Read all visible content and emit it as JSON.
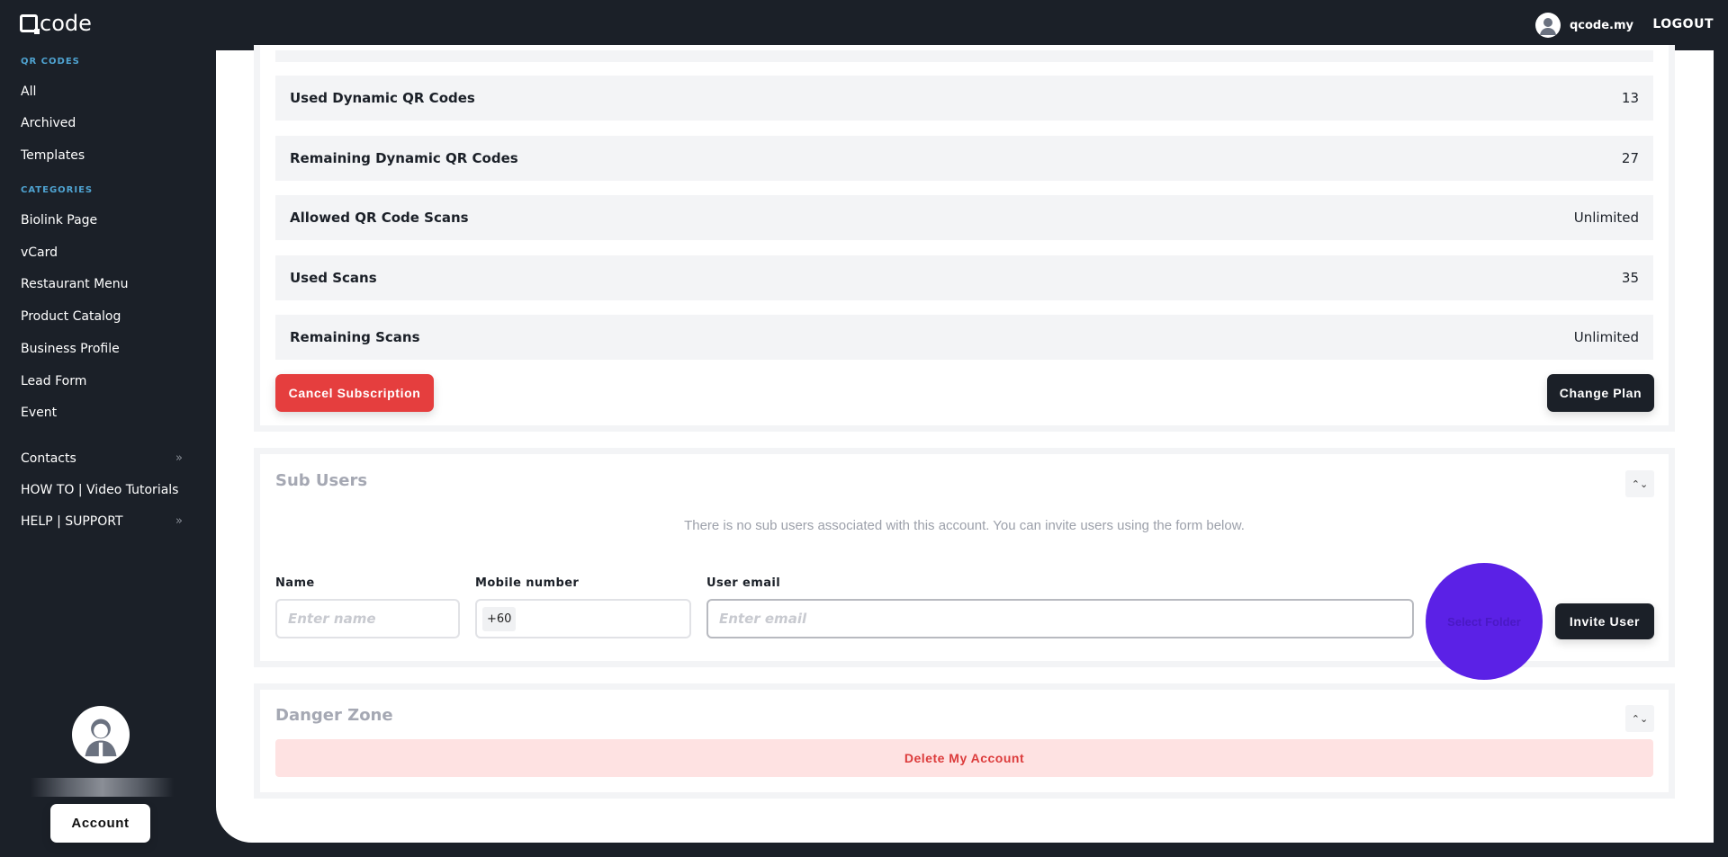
{
  "header": {
    "logo": "code",
    "username": "qcode.my",
    "logout": "LOGOUT"
  },
  "sidebar": {
    "qr_heading": "QR CODES",
    "qr_items": [
      "All",
      "Archived",
      "Templates"
    ],
    "cat_heading": "CATEGORIES",
    "cat_items": [
      "Biolink Page",
      "vCard",
      "Restaurant Menu",
      "Product Catalog",
      "Business Profile",
      "Lead Form",
      "Event"
    ],
    "extra_items": [
      "Contacts",
      "HOW TO | Video Tutorials",
      "HELP | SUPPORT"
    ],
    "account_button": "Account"
  },
  "subscription": {
    "rows": [
      {
        "label": "Used Dynamic QR Codes",
        "value": "13"
      },
      {
        "label": "Remaining Dynamic QR Codes",
        "value": "27"
      },
      {
        "label": "Allowed QR Code Scans",
        "value": "Unlimited"
      },
      {
        "label": "Used Scans",
        "value": "35"
      },
      {
        "label": "Remaining Scans",
        "value": "Unlimited"
      }
    ],
    "cancel_button": "Cancel Subscription",
    "change_button": "Change Plan"
  },
  "sub_users": {
    "title": "Sub Users",
    "message": "There is no sub users associated with this account. You can invite users using the form below.",
    "name_label": "Name",
    "name_placeholder": "Enter name",
    "mobile_label": "Mobile number",
    "mobile_prefix": "+60",
    "email_label": "User email",
    "email_placeholder": "Enter email",
    "select_folder": "Select Folder",
    "invite_button": "Invite User"
  },
  "danger_zone": {
    "title": "Danger Zone",
    "delete_button": "Delete My Account"
  },
  "colors": {
    "sidebar": "#1b2028",
    "danger": "#e53e3e",
    "accent": "#5b21e6"
  }
}
